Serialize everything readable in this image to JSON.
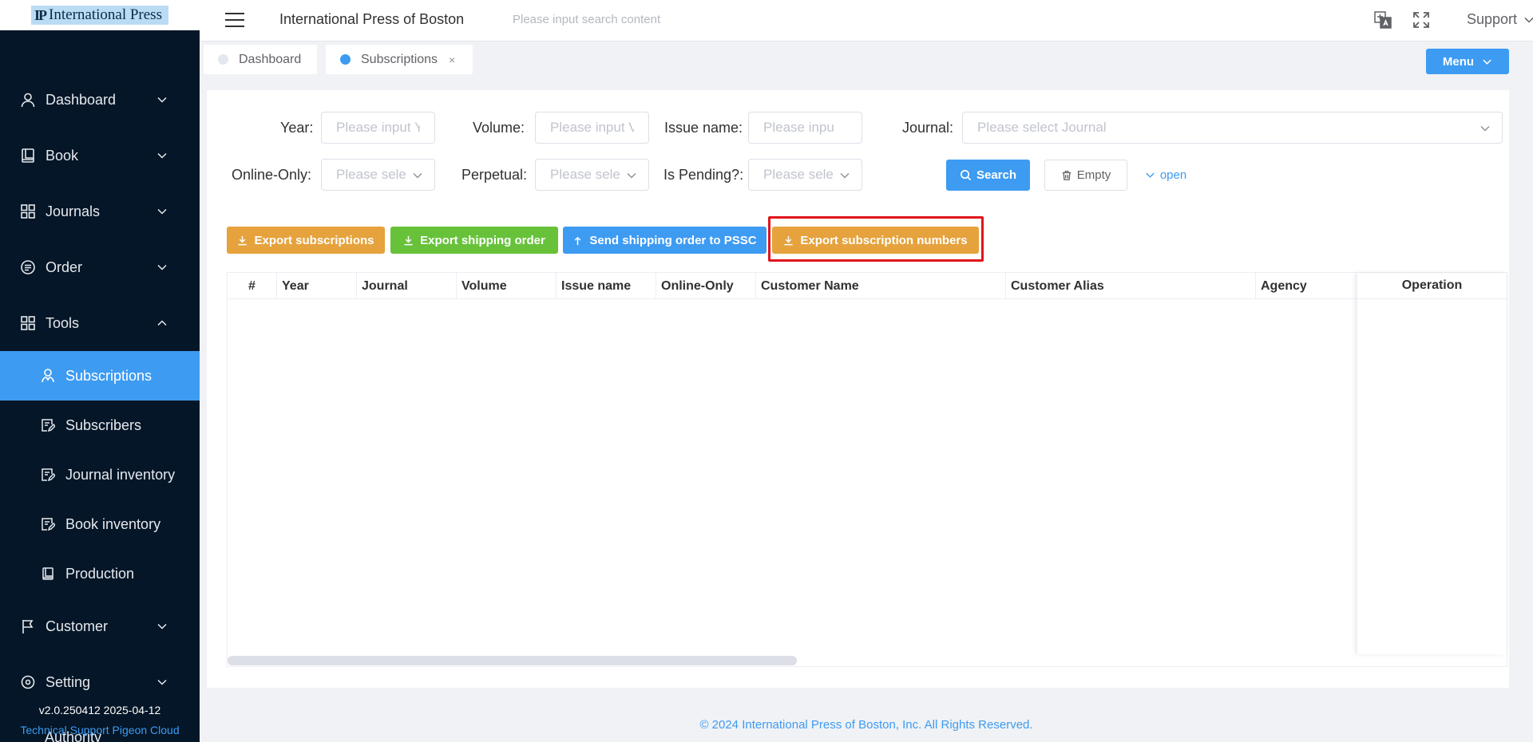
{
  "logo": {
    "text": "International Press"
  },
  "sidebar": {
    "items": [
      {
        "label": "Dashboard",
        "icon": "user-icon"
      },
      {
        "label": "Book",
        "icon": "book-icon"
      },
      {
        "label": "Journals",
        "icon": "grid-icon"
      },
      {
        "label": "Order",
        "icon": "list-icon"
      },
      {
        "label": "Tools",
        "icon": "grid-icon",
        "expanded": true
      }
    ],
    "sub_items": [
      {
        "label": "Subscriptions",
        "icon": "subscriber-icon",
        "active": true
      },
      {
        "label": "Subscribers",
        "icon": "edit-doc-icon"
      },
      {
        "label": "Journal inventory",
        "icon": "edit-doc-icon"
      },
      {
        "label": "Book inventory",
        "icon": "edit-doc-icon"
      },
      {
        "label": "Production",
        "icon": "book-icon"
      }
    ],
    "after_items": [
      {
        "label": "Customer",
        "icon": "flag-icon"
      },
      {
        "label": "Setting",
        "icon": "setting-icon"
      }
    ],
    "peek_item": "Authority",
    "version": "v2.0.250412 2025-04-12",
    "tech_support": "Technical Support Pigeon Cloud"
  },
  "header": {
    "title": "International Press of Boston",
    "search_placeholder": "Please input search content",
    "support_label": "Support"
  },
  "tabs": [
    {
      "label": "Dashboard",
      "active": false
    },
    {
      "label": "Subscriptions",
      "active": true,
      "close": "×"
    }
  ],
  "menu_button": "Menu",
  "filters": {
    "year_label": "Year:",
    "year_placeholder": "Please input Y",
    "volume_label": "Volume:",
    "volume_placeholder": "Please input V",
    "issue_label": "Issue name:",
    "issue_placeholder": "Please inpu",
    "journal_label": "Journal:",
    "journal_placeholder": "Please select Journal",
    "online_label": "Online-Only:",
    "online_placeholder": "Please sele",
    "perpetual_label": "Perpetual:",
    "perpetual_placeholder": "Please sele",
    "pending_label": "Is Pending?:",
    "pending_placeholder": "Please sele",
    "search_button": "Search",
    "empty_button": "Empty",
    "open_button": "open"
  },
  "actions": {
    "export_subscriptions": "Export subscriptions",
    "export_shipping": "Export shipping order",
    "send_shipping": "Send shipping order to PSSC",
    "export_numbers": "Export subscription numbers"
  },
  "table": {
    "columns": [
      "#",
      "Year",
      "Journal",
      "Volume",
      "Issue name",
      "Online-Only",
      "Customer Name",
      "Customer Alias",
      "Agency"
    ],
    "operation": "Operation"
  },
  "footer": "© 2024 International Press of Boston, Inc. All Rights Reserved.",
  "colors": {
    "sidebar_bg": "#041627",
    "primary": "#3d9bf2",
    "warning": "#e6a23c",
    "success": "#67c23a",
    "highlight": "#e0151b"
  }
}
